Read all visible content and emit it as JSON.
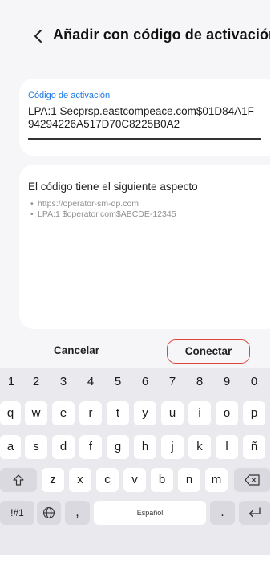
{
  "header": {
    "title": "Añadir con código de activación"
  },
  "field": {
    "label": "Código de activación",
    "value": "LPA:1 Secprsp.eastcompeace.com$01D84A1F94294226A517D70C8225B0A2"
  },
  "hint": {
    "title": "El código tiene el siguiente aspecto",
    "examples": [
      "https://operator-sm-dp.com",
      "LPA:1 $operator.com$ABCDE-12345"
    ]
  },
  "actions": {
    "cancel": "Cancelar",
    "connect": "Conectar",
    "connect_border": "#e0443c"
  },
  "keyboard": {
    "row1": [
      "1",
      "2",
      "3",
      "4",
      "5",
      "6",
      "7",
      "8",
      "9",
      "0"
    ],
    "row2": [
      "q",
      "w",
      "e",
      "r",
      "t",
      "y",
      "u",
      "i",
      "o",
      "p"
    ],
    "row3": [
      "a",
      "s",
      "d",
      "f",
      "g",
      "h",
      "j",
      "k",
      "l",
      "ñ"
    ],
    "row4": [
      "z",
      "x",
      "c",
      "v",
      "b",
      "n",
      "m"
    ],
    "symbols": "!#1",
    "comma": ",",
    "space": "Español",
    "period": "."
  },
  "colors": {
    "accent": "#1e78e6",
    "background": "#f6f6f8",
    "card": "#ffffff"
  }
}
